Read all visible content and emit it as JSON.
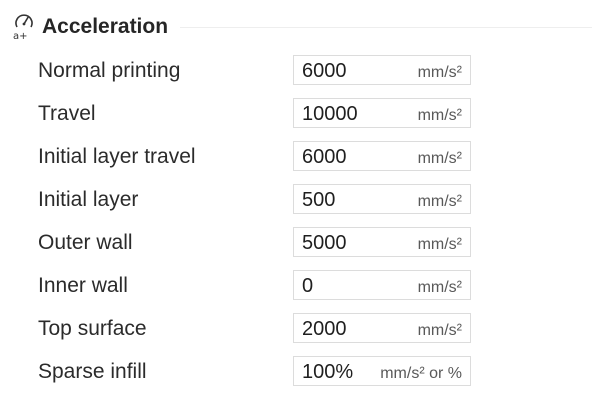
{
  "section": {
    "title": "Acceleration",
    "icon": "acceleration-gauge-icon"
  },
  "rows": [
    {
      "label": "Normal printing",
      "value": "6000",
      "unit": "mm/s²"
    },
    {
      "label": "Travel",
      "value": "10000",
      "unit": "mm/s²"
    },
    {
      "label": "Initial layer travel",
      "value": "6000",
      "unit": "mm/s²"
    },
    {
      "label": "Initial layer",
      "value": "500",
      "unit": "mm/s²"
    },
    {
      "label": "Outer wall",
      "value": "5000",
      "unit": "mm/s²"
    },
    {
      "label": "Inner wall",
      "value": "0",
      "unit": "mm/s²"
    },
    {
      "label": "Top surface",
      "value": "2000",
      "unit": "mm/s²"
    },
    {
      "label": "Sparse infill",
      "value": "100%",
      "unit": "mm/s² or %"
    }
  ]
}
